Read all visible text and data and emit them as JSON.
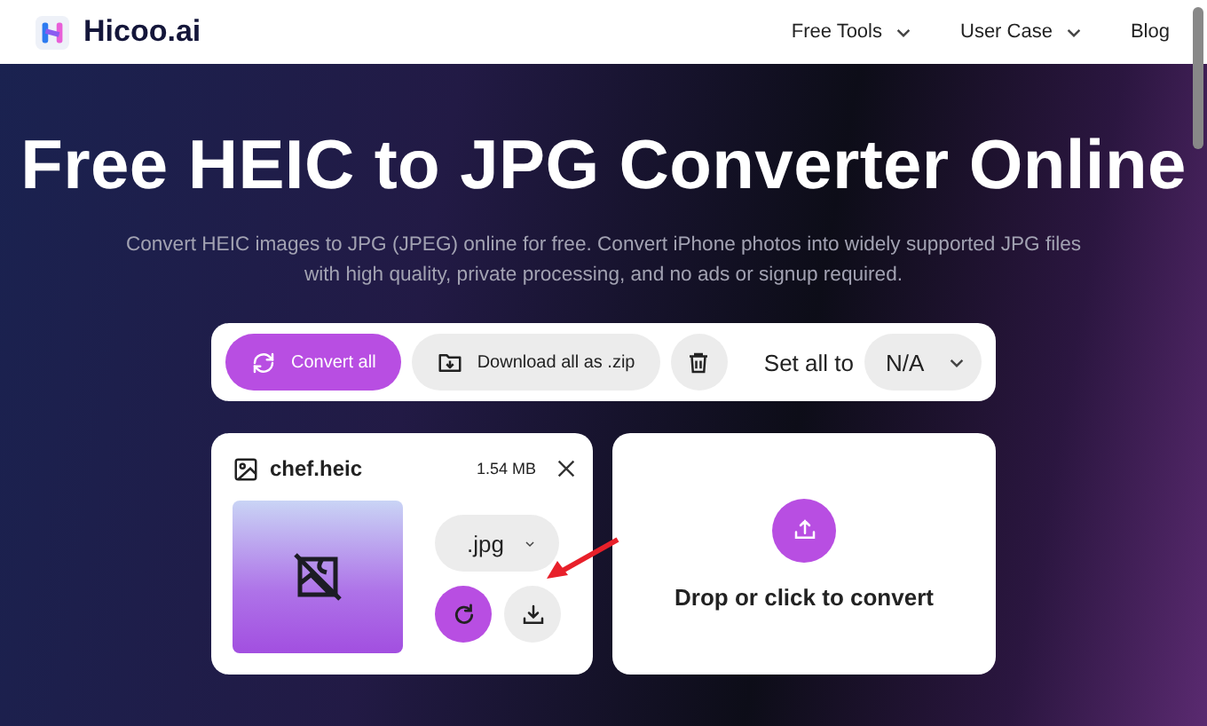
{
  "header": {
    "brand": "Hicoo.ai",
    "nav": [
      {
        "label": "Free Tools",
        "kind": "dropdown"
      },
      {
        "label": "User Case",
        "kind": "dropdown"
      },
      {
        "label": "Blog",
        "kind": "link"
      }
    ]
  },
  "hero": {
    "title": "Free HEIC to JPG Converter Online",
    "subtitle": "Convert HEIC images to JPG (JPEG) online for free. Convert iPhone photos into widely supported JPG files with high quality, private processing, and no ads or signup required."
  },
  "toolbar": {
    "convert_all": "Convert all",
    "download_zip": "Download all as .zip",
    "set_all_label": "Set all to",
    "set_all_value": "N/A"
  },
  "files": [
    {
      "name": "chef.heic",
      "size": "1.54 MB",
      "format": ".jpg"
    }
  ],
  "dropzone": {
    "label": "Drop or click to convert"
  }
}
